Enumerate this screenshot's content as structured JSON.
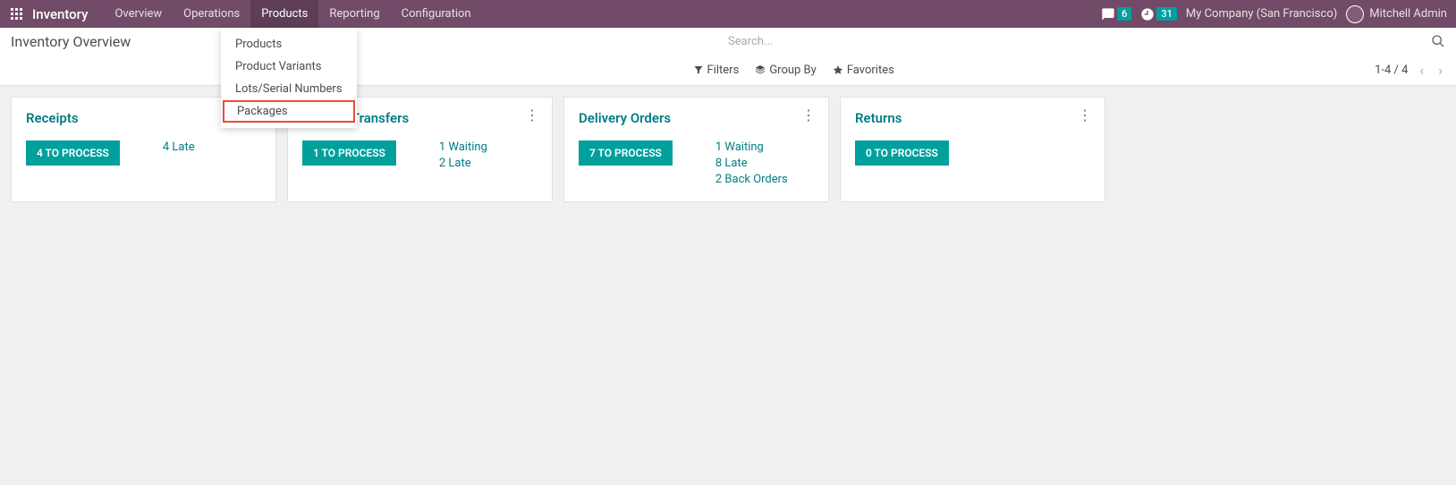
{
  "navbar": {
    "brand": "Inventory",
    "items": [
      "Overview",
      "Operations",
      "Products",
      "Reporting",
      "Configuration"
    ],
    "active_index": 2,
    "chat_badge": "6",
    "activity_badge": "31",
    "company": "My Company (San Francisco)",
    "user": "Mitchell Admin"
  },
  "dropdown": {
    "items": [
      "Products",
      "Product Variants",
      "Lots/Serial Numbers",
      "Packages"
    ],
    "highlighted_index": 3
  },
  "breadcrumb": "Inventory Overview",
  "search": {
    "placeholder": "Search..."
  },
  "filters": {
    "filters": "Filters",
    "groupby": "Group By",
    "favorites": "Favorites"
  },
  "pager": "1-4 / 4",
  "cards": [
    {
      "title": "Receipts",
      "button": "4 TO PROCESS",
      "statuses": [
        "4 Late"
      ],
      "has_menu": false
    },
    {
      "title": "Internal Transfers",
      "button": "1 TO PROCESS",
      "statuses": [
        "1 Waiting",
        "2 Late"
      ],
      "has_menu": true
    },
    {
      "title": "Delivery Orders",
      "button": "7 TO PROCESS",
      "statuses": [
        "1 Waiting",
        "8 Late",
        "2 Back Orders"
      ],
      "has_menu": true
    },
    {
      "title": "Returns",
      "button": "0 TO PROCESS",
      "statuses": [],
      "has_menu": true
    }
  ]
}
